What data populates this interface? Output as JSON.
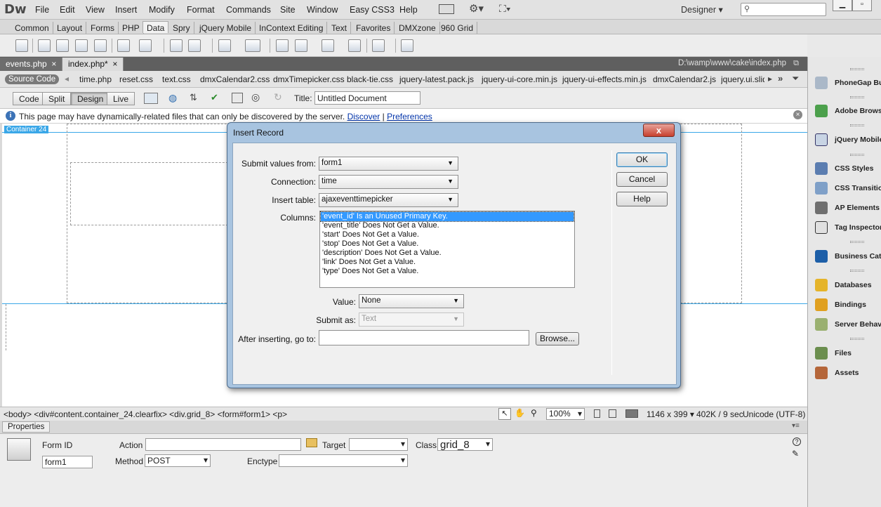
{
  "app": {
    "logo": "Dw"
  },
  "menu": [
    "File",
    "Edit",
    "View",
    "Insert",
    "Modify",
    "Format",
    "Commands",
    "Site",
    "Window",
    "Easy CSS3",
    "Help"
  ],
  "workspace": {
    "label": "Designer ▾"
  },
  "insert_tabs": [
    "Common",
    "Layout",
    "Forms",
    "PHP",
    "Data",
    "Spry",
    "jQuery Mobile",
    "InContext Editing",
    "Text",
    "Favorites",
    "DMXzone",
    "960 Grid"
  ],
  "insert_active": "Data",
  "doc_tabs": [
    {
      "label": "events.php",
      "close": "×"
    },
    {
      "label": "index.php*",
      "close": "×"
    }
  ],
  "doc_path": "D:\\wamp\\www\\cake\\index.php",
  "related": {
    "source_code": "Source Code",
    "files": [
      "time.php",
      "reset.css",
      "text.css",
      "dmxCalendar2.css",
      "dmxTimepicker.css",
      "black-tie.css",
      "jquery-latest.pack.js",
      "jquery-ui-core.min.js",
      "jquery-ui-effects.min.js",
      "dmxCalendar2.js",
      "jquery.ui.slid"
    ]
  },
  "view": {
    "code": "Code",
    "split": "Split",
    "design": "Design",
    "live": "Live",
    "title_label": "Title:",
    "title_value": "Untitled Document"
  },
  "info": {
    "text": "This page may have dynamically-related files that can only be discovered by the server.",
    "discover": "Discover",
    "sep": "|",
    "preferences": "Preferences"
  },
  "design": {
    "container_tag": "Container 24"
  },
  "status": {
    "tags": "<body> <div#content.container_24.clearfix> <div.grid_8> <form#form1> <p>",
    "zoom": "100%",
    "size": "1146 x 399 ▾",
    "download": "402K / 9 sec",
    "encoding": "Unicode (UTF-8)"
  },
  "properties": {
    "title": "Properties",
    "form_id_label": "Form ID",
    "form_id_value": "form1",
    "action_label": "Action",
    "action_value": "",
    "target_label": "Target",
    "target_value": "",
    "class_label": "Class",
    "class_value": "grid_8",
    "method_label": "Method",
    "method_value": "POST",
    "enctype_label": "Enctype",
    "enctype_value": ""
  },
  "panels": [
    "PhoneGap Buil",
    "Adobe Browse",
    "jQuery Mobile",
    "CSS Styles",
    "CSS Transitio",
    "AP Elements",
    "Tag Inspector",
    "Business Cataly",
    "Databases",
    "Bindings",
    "Server Behavio",
    "Files",
    "Assets"
  ],
  "dialog": {
    "title": "Insert Record",
    "close": "x",
    "submit_from_label": "Submit values from:",
    "submit_from_value": "form1",
    "connection_label": "Connection:",
    "connection_value": "time",
    "insert_table_label": "Insert table:",
    "insert_table_value": "ajaxeventtimepicker",
    "columns_label": "Columns:",
    "columns": [
      "'event_id' Is an Unused Primary Key.",
      "'event_title' Does Not Get a Value.",
      "'start' Does Not Get a Value.",
      "'stop' Does Not Get a Value.",
      "'description' Does Not Get a Value.",
      "'link' Does Not Get a Value.",
      "'type' Does Not Get a Value."
    ],
    "value_label": "Value:",
    "value_value": "None",
    "submit_as_label": "Submit as:",
    "submit_as_value": "Text",
    "after_label": "After inserting, go to:",
    "after_value": "",
    "browse": "Browse...",
    "ok": "OK",
    "cancel": "Cancel",
    "help": "Help"
  }
}
